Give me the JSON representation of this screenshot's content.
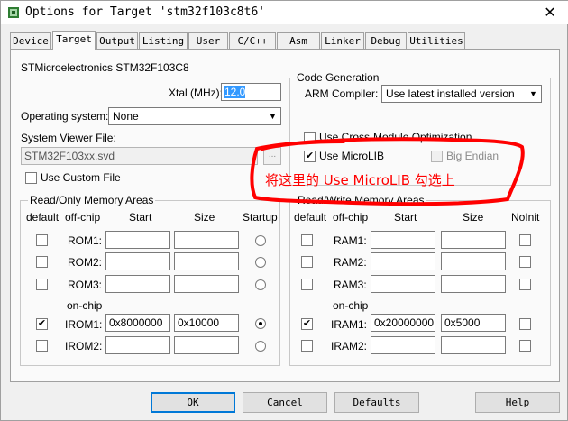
{
  "window": {
    "title": "Options for Target 'stm32f103c8t6'",
    "close_glyph": "✕"
  },
  "tabs": [
    {
      "label": "Device"
    },
    {
      "label": "Target"
    },
    {
      "label": "Output"
    },
    {
      "label": "Listing"
    },
    {
      "label": "User"
    },
    {
      "label": "C/C++"
    },
    {
      "label": "Asm"
    },
    {
      "label": "Linker"
    },
    {
      "label": "Debug"
    },
    {
      "label": "Utilities"
    }
  ],
  "device": {
    "name": "STMicroelectronics STM32F103C8",
    "xtal_label": "Xtal (MHz):",
    "xtal_value": "12.0",
    "os_label": "Operating system:",
    "os_value": "None",
    "svd_label": "System Viewer File:",
    "svd_value": "STM32F103xx.svd",
    "svd_browse": "...",
    "custom_file_label": "Use Custom File"
  },
  "codegen": {
    "group_title": "Code Generation",
    "compiler_label": "ARM Compiler:",
    "compiler_value": "Use latest installed version",
    "cross_module_label": "Use Cross-Module Optimization",
    "microlib_label": "Use MicroLIB",
    "big_endian_label": "Big Endian"
  },
  "annotation": {
    "text": "将这里的 Use MicroLIB 勾选上",
    "color": "#ff0000"
  },
  "rom": {
    "group_title": "Read/Only Memory Areas",
    "headers": {
      "default": "default",
      "offchip": "off-chip",
      "start": "Start",
      "size": "Size",
      "startup": "Startup"
    },
    "onchip_label": "on-chip",
    "rows": [
      {
        "name": "ROM1:",
        "start": "",
        "size": "",
        "default": false,
        "startup": false
      },
      {
        "name": "ROM2:",
        "start": "",
        "size": "",
        "default": false,
        "startup": false
      },
      {
        "name": "ROM3:",
        "start": "",
        "size": "",
        "default": false,
        "startup": false
      },
      {
        "name": "IROM1:",
        "start": "0x8000000",
        "size": "0x10000",
        "default": true,
        "startup": true
      },
      {
        "name": "IROM2:",
        "start": "",
        "size": "",
        "default": false,
        "startup": false
      }
    ]
  },
  "ram": {
    "group_title": "Read/Write Memory Areas",
    "headers": {
      "default": "default",
      "offchip": "off-chip",
      "start": "Start",
      "size": "Size",
      "noinit": "NoInit"
    },
    "onchip_label": "on-chip",
    "rows": [
      {
        "name": "RAM1:",
        "start": "",
        "size": "",
        "default": false,
        "noinit": false
      },
      {
        "name": "RAM2:",
        "start": "",
        "size": "",
        "default": false,
        "noinit": false
      },
      {
        "name": "RAM3:",
        "start": "",
        "size": "",
        "default": false,
        "noinit": false
      },
      {
        "name": "IRAM1:",
        "start": "0x20000000",
        "size": "0x5000",
        "default": true,
        "noinit": false
      },
      {
        "name": "IRAM2:",
        "start": "",
        "size": "",
        "default": false,
        "noinit": false
      }
    ]
  },
  "buttons": {
    "ok": "OK",
    "cancel": "Cancel",
    "defaults": "Defaults",
    "help": "Help"
  },
  "marks": {
    "check": "✔"
  }
}
